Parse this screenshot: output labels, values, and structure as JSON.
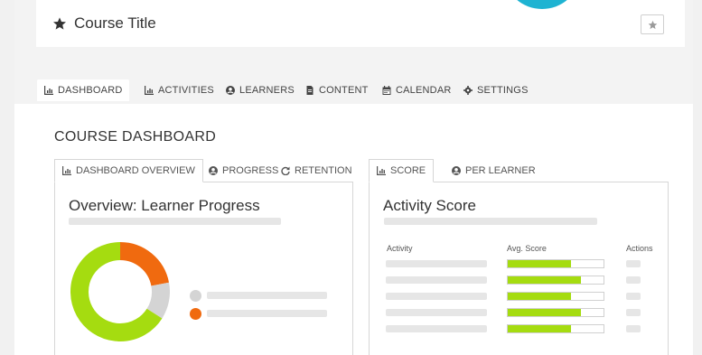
{
  "header": {
    "course_title": "Course Title"
  },
  "nav": {
    "tabs": [
      {
        "label": "DASHBOARD",
        "icon": "chart-icon"
      },
      {
        "label": "ACTIVITIES",
        "icon": "chart-icon"
      },
      {
        "label": "LEARNERS",
        "icon": "user-icon"
      },
      {
        "label": "CONTENT",
        "icon": "file-icon"
      },
      {
        "label": "CALENDAR",
        "icon": "calendar-icon"
      },
      {
        "label": "SETTINGS",
        "icon": "gear-icon"
      }
    ],
    "active": "DASHBOARD"
  },
  "dashboard": {
    "title": "COURSE DASHBOARD",
    "left_tabs": [
      {
        "label": "DASHBOARD OVERVIEW",
        "icon": "chart-icon"
      },
      {
        "label": "PROGRESS",
        "icon": "user-icon"
      },
      {
        "label": "RETENTION",
        "icon": "refresh-icon"
      }
    ],
    "right_tabs": [
      {
        "label": "SCORE",
        "icon": "chart-icon"
      },
      {
        "label": "PER LEARNER",
        "icon": "user-icon"
      }
    ],
    "overview": {
      "heading": "Overview: Learner Progress",
      "donut_fractions": {
        "green": 0.66,
        "orange": 0.22,
        "gray": 0.12
      }
    },
    "activity_score": {
      "heading": "Activity Score",
      "columns": {
        "activity": "Activity",
        "avg_score": "Avg. Score",
        "actions": "Actions"
      },
      "score_fractions": [
        0.66,
        0.76,
        0.66,
        0.76,
        0.66
      ]
    }
  },
  "colors": {
    "green": "#a5dc10",
    "orange": "#f06a0f",
    "gray": "#d4d4d4",
    "accent": "#1eb3d2"
  }
}
